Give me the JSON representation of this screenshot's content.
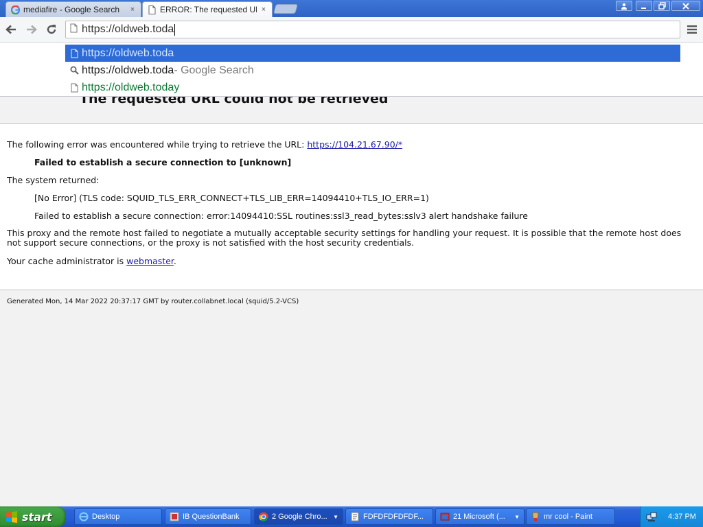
{
  "browser": {
    "tabs": [
      {
        "title": "mediafire - Google Search",
        "close": "×",
        "favicon": "google-g-icon",
        "active": false
      },
      {
        "title": "ERROR: The requested URL c",
        "close": "×",
        "favicon": "page-icon",
        "active": true
      }
    ],
    "address_bar": {
      "value": "https://oldweb.toda"
    },
    "suggestions": [
      {
        "text": "https://oldweb.toda",
        "suffix": "",
        "icon": "page-icon",
        "selected": true
      },
      {
        "text": "https://oldweb.toda",
        "suffix": " - Google Search",
        "icon": "search-icon",
        "selected": false
      },
      {
        "text": "https://oldweb.today",
        "suffix": "",
        "icon": "page-icon",
        "selected": false
      }
    ]
  },
  "page": {
    "title": "The requested URL could not be retrieved",
    "error_intro": "The following error was encountered while trying to retrieve the URL: ",
    "error_url": "https://104.21.67.90/*",
    "failed_message": "Failed to establish a secure connection to [unknown]",
    "system_returned_label": "The system returned:",
    "no_error_detail": "[No Error] (TLS code: SQUID_TLS_ERR_CONNECT+TLS_LIB_ERR=14094410+TLS_IO_ERR=1)",
    "ssl_detail": "Failed to establish a secure connection: error:14094410:SSL routines:ssl3_read_bytes:sslv3 alert handshake failure",
    "explanation": "This proxy and the remote host failed to negotiate a mutually acceptable security settings for handling your request. It is possible that the remote host does not support secure connections, or the proxy is not satisfied with the host security credentials.",
    "admin_prefix": "Your cache administrator is ",
    "admin_link": "webmaster",
    "admin_suffix": ".",
    "footer": "Generated Mon, 14 Mar 2022 20:37:17 GMT by router.collabnet.local (squid/5.2-VCS)"
  },
  "taskbar": {
    "start_label": "start",
    "tasks": [
      {
        "label": "Desktop",
        "icon": "ie-icon"
      },
      {
        "label": "IB QuestionBank",
        "icon": "window-icon"
      },
      {
        "label": "2 Google Chro...",
        "icon": "chrome-icon",
        "active": true
      },
      {
        "label": "FDFDFDFDFDF...",
        "icon": "document-icon"
      },
      {
        "label": "21 Microsoft (...",
        "icon": "office-icon"
      },
      {
        "label": "mr cool - Paint",
        "icon": "paint-icon"
      }
    ],
    "clock": "4:37 PM"
  },
  "colors": {
    "titlebar": "#2f63c4",
    "suggestion_selected": "#2f6bd6",
    "link": "#1a1aa8",
    "taskbar": "#245ed8",
    "start_button": "#3c9b3c",
    "tray": "#1587d6"
  }
}
